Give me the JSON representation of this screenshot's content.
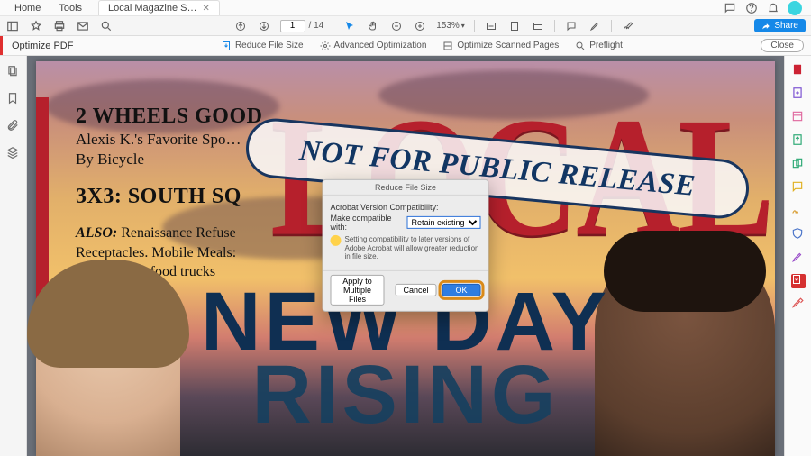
{
  "menubar": {
    "home": "Home",
    "tools": "Tools",
    "doc_title": "Local Magazine S…"
  },
  "toolbar": {
    "page_current": "1",
    "page_total": "/ 14",
    "zoom": "153%",
    "share": "Share"
  },
  "optimize": {
    "title": "Optimize PDF",
    "reduce": "Reduce File Size",
    "advanced": "Advanced Optimization",
    "scanned": "Optimize Scanned Pages",
    "preflight": "Preflight",
    "close": "Close"
  },
  "cover": {
    "masthead": "LOCAL",
    "h1": "2 WHEELS GOOD",
    "sub1": "Alexis K.'s Favorite Spo…",
    "sub2": "By Bicycle",
    "h2": "3X3: SOUTH SQ",
    "also_label": "ALSO:",
    "also_1": "Renaissance Refuse",
    "also_2": "Receptacles. Mobile Meals:",
    "also_3": "Our favorite food trucks",
    "stamp": "NOT FOR PUBLIC RELEASE",
    "big1": "NEW DAY",
    "big2": "RISING"
  },
  "dialog": {
    "title": "Reduce File Size",
    "compat_label": "Acrobat Version Compatibility:",
    "make_compat": "Make compatible with:",
    "select_value": "Retain existing",
    "tip": "Setting compatibility to later versions of Adobe Acrobat will allow greater reduction in file size.",
    "apply_multi": "Apply to Multiple Files",
    "cancel": "Cancel",
    "ok": "OK"
  },
  "right_icons": [
    "export-pdf",
    "create-pdf",
    "edit-pdf",
    "comment",
    "combine",
    "organize",
    "redact",
    "protect",
    "compress",
    "sign",
    "more-tools"
  ]
}
